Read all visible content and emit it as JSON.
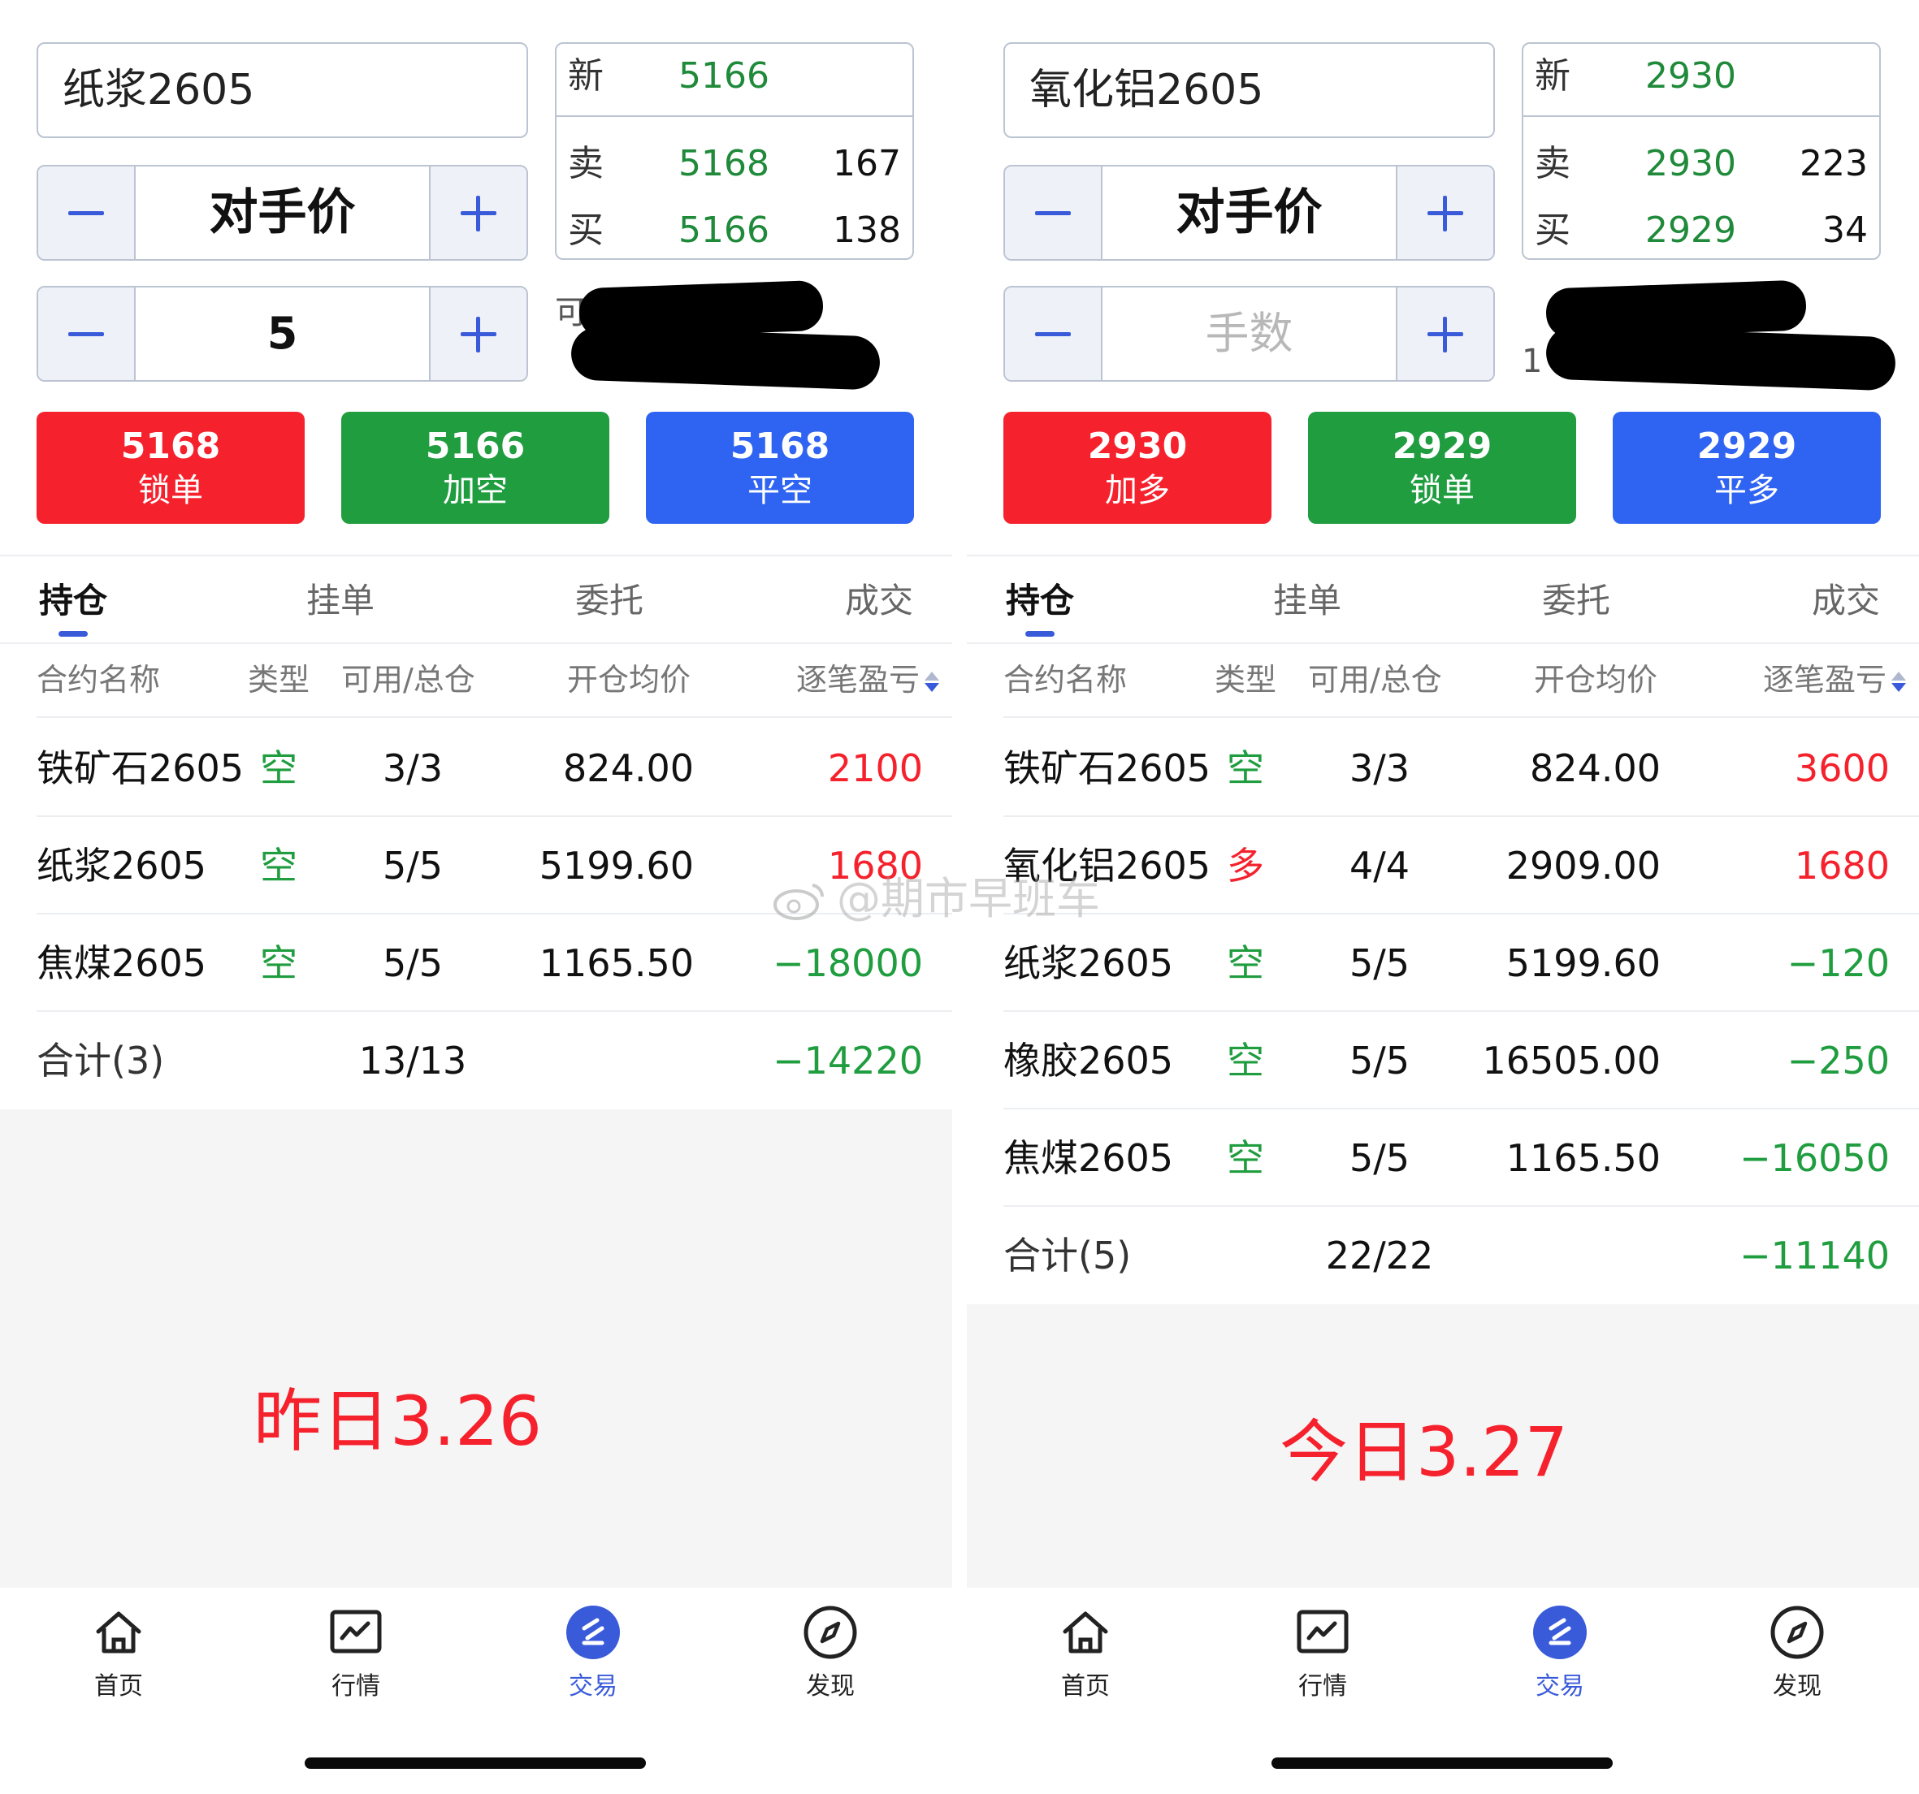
{
  "left": {
    "symbol": "纸浆2605",
    "price_mode": "对手价",
    "quantity": "5",
    "quantity_placeholder": "",
    "quote": {
      "last_label": "新",
      "last_price": "5166",
      "ask_label": "卖",
      "ask_price": "5168",
      "ask_volume": "167",
      "bid_label": "买",
      "bid_price": "5166",
      "bid_volume": "138"
    },
    "redacted_peek": "可",
    "actions": [
      {
        "price": "5168",
        "label": "锁单"
      },
      {
        "price": "5166",
        "label": "加空"
      },
      {
        "price": "5168",
        "label": "平空"
      }
    ],
    "tabs": [
      "持仓",
      "挂单",
      "委托",
      "成交"
    ],
    "columns": [
      "合约名称",
      "类型",
      "可用/总仓",
      "开仓均价",
      "逐笔盈亏"
    ],
    "rows": [
      {
        "name": "铁矿石2605",
        "type": "空",
        "avail": "3/3",
        "avg": "824.00",
        "pnl": "2100",
        "sign": "pos",
        "side": "short"
      },
      {
        "name": "纸浆2605",
        "type": "空",
        "avail": "5/5",
        "avg": "5199.60",
        "pnl": "1680",
        "sign": "pos",
        "side": "short"
      },
      {
        "name": "焦煤2605",
        "type": "空",
        "avail": "5/5",
        "avg": "1165.50",
        "pnl": "−18000",
        "sign": "neg",
        "side": "short"
      }
    ],
    "total": {
      "label": "合计(3)",
      "avail": "13/13",
      "pnl": "−14220"
    },
    "date_note": "昨日3.26"
  },
  "right": {
    "symbol": "氧化铝2605",
    "price_mode": "对手价",
    "quantity": "",
    "quantity_placeholder": "手数",
    "quote": {
      "last_label": "新",
      "last_price": "2930",
      "ask_label": "卖",
      "ask_price": "2930",
      "ask_volume": "223",
      "bid_label": "买",
      "bid_price": "2929",
      "bid_volume": "34"
    },
    "redacted_peek": "1",
    "actions": [
      {
        "price": "2930",
        "label": "加多"
      },
      {
        "price": "2929",
        "label": "锁单"
      },
      {
        "price": "2929",
        "label": "平多"
      }
    ],
    "tabs": [
      "持仓",
      "挂单",
      "委托",
      "成交"
    ],
    "columns": [
      "合约名称",
      "类型",
      "可用/总仓",
      "开仓均价",
      "逐笔盈亏"
    ],
    "rows": [
      {
        "name": "铁矿石2605",
        "type": "空",
        "avail": "3/3",
        "avg": "824.00",
        "pnl": "3600",
        "sign": "pos",
        "side": "short"
      },
      {
        "name": "氧化铝2605",
        "type": "多",
        "avail": "4/4",
        "avg": "2909.00",
        "pnl": "1680",
        "sign": "pos",
        "side": "long"
      },
      {
        "name": "纸浆2605",
        "type": "空",
        "avail": "5/5",
        "avg": "5199.60",
        "pnl": "−120",
        "sign": "neg",
        "side": "short"
      },
      {
        "name": "橡胶2605",
        "type": "空",
        "avail": "5/5",
        "avg": "16505.00",
        "pnl": "−250",
        "sign": "neg",
        "side": "short"
      },
      {
        "name": "焦煤2605",
        "type": "空",
        "avail": "5/5",
        "avg": "1165.50",
        "pnl": "−16050",
        "sign": "neg",
        "side": "short"
      }
    ],
    "total": {
      "label": "合计(5)",
      "avail": "22/22",
      "pnl": "−11140"
    },
    "date_note": "今日3.27"
  },
  "nav": [
    {
      "label": "首页",
      "icon": "home-icon",
      "active": false
    },
    {
      "label": "行情",
      "icon": "chart-icon",
      "active": false
    },
    {
      "label": "交易",
      "icon": "trade-icon",
      "active": true
    },
    {
      "label": "发现",
      "icon": "compass-icon",
      "active": false
    }
  ],
  "watermark": "@期市早班车",
  "colors": {
    "accent": "#3a5bd9",
    "red": "#f5222d",
    "green": "#1f9d3f",
    "blue_button": "#2f63f2"
  }
}
